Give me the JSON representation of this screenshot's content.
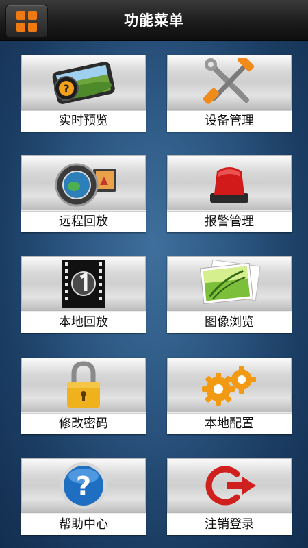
{
  "header": {
    "title": "功能菜单",
    "menu_icon": "grid-icon",
    "accent": "#f07a12"
  },
  "menu": {
    "items": [
      {
        "label": "实时预览",
        "icon": "live-preview-icon"
      },
      {
        "label": "设备管理",
        "icon": "tools-icon"
      },
      {
        "label": "远程回放",
        "icon": "remote-playback-icon"
      },
      {
        "label": "报警管理",
        "icon": "alarm-siren-icon"
      },
      {
        "label": "本地回放",
        "icon": "film-reel-icon"
      },
      {
        "label": "图像浏览",
        "icon": "photo-gallery-icon"
      },
      {
        "label": "修改密码",
        "icon": "padlock-icon"
      },
      {
        "label": "本地配置",
        "icon": "gears-icon"
      },
      {
        "label": "帮助中心",
        "icon": "help-icon"
      },
      {
        "label": "注销登录",
        "icon": "logout-icon"
      }
    ]
  }
}
